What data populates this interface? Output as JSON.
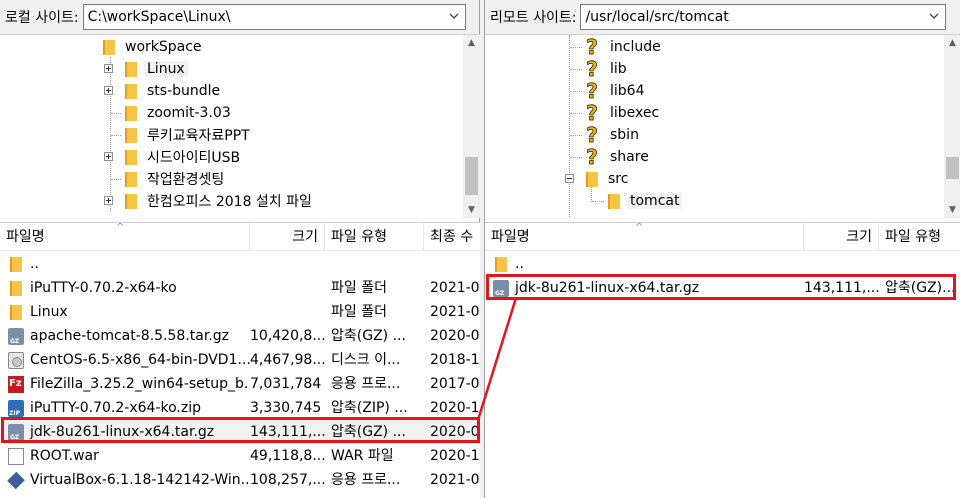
{
  "local": {
    "label": "로컬 사이트:",
    "path": "C:\\workSpace\\Linux\\",
    "tree": [
      {
        "label": "workSpace",
        "icon": "folder-icon",
        "expander": "none"
      },
      {
        "label": "Linux",
        "icon": "folder-icon",
        "expander": "plus",
        "selected": true
      },
      {
        "label": "sts-bundle",
        "icon": "folder-icon",
        "expander": "plus"
      },
      {
        "label": "zoomit-3.03",
        "icon": "folder-icon",
        "expander": "none"
      },
      {
        "label": "루키교육자료PPT",
        "icon": "folder-icon",
        "expander": "none"
      },
      {
        "label": "시드아이티USB",
        "icon": "folder-icon",
        "expander": "plus"
      },
      {
        "label": "작업환경셋팅",
        "icon": "folder-icon",
        "expander": "none"
      },
      {
        "label": "한컴오피스 2018 설치 파일",
        "icon": "folder-icon",
        "expander": "plus"
      }
    ],
    "columns": {
      "name": "파일명",
      "size": "크기",
      "type": "파일 유형",
      "modified": "최종 수"
    },
    "files": [
      {
        "name": "..",
        "size": "",
        "type": "",
        "modified": "",
        "icon": "folder"
      },
      {
        "name": "iPuTTY-0.70.2-x64-ko",
        "size": "",
        "type": "파일 폴더",
        "modified": "2021-0",
        "icon": "folder"
      },
      {
        "name": "Linux",
        "size": "",
        "type": "파일 폴더",
        "modified": "2021-0",
        "icon": "folder"
      },
      {
        "name": "apache-tomcat-8.5.58.tar.gz",
        "size": "10,420,8...",
        "type": "압축(GZ) ...",
        "modified": "2020-0",
        "icon": "gz"
      },
      {
        "name": "CentOS-6.5-x86_64-bin-DVD1....",
        "size": "4,467,98...",
        "type": "디스크 이...",
        "modified": "2018-1",
        "icon": "iso"
      },
      {
        "name": "FileZilla_3.25.2_win64-setup_b...",
        "size": "7,031,784",
        "type": "응용 프로...",
        "modified": "2017-0",
        "icon": "fz"
      },
      {
        "name": "iPuTTY-0.70.2-x64-ko.zip",
        "size": "3,330,745",
        "type": "압축(ZIP) ...",
        "modified": "2020-1",
        "icon": "zip"
      },
      {
        "name": "jdk-8u261-linux-x64.tar.gz",
        "size": "143,111,...",
        "type": "압축(GZ) ...",
        "modified": "2020-0",
        "icon": "gz",
        "selected": true
      },
      {
        "name": "ROOT.war",
        "size": "49,118,8...",
        "type": "WAR 파일",
        "modified": "2020-1",
        "icon": "war"
      },
      {
        "name": "VirtualBox-6.1.18-142142-Win....",
        "size": "108,257,...",
        "type": "응용 프로...",
        "modified": "2021-0",
        "icon": "vbox"
      }
    ]
  },
  "remote": {
    "label": "리모트 사이트:",
    "path": "/usr/local/src/tomcat",
    "tree": [
      {
        "label": "include",
        "icon": "question-icon"
      },
      {
        "label": "lib",
        "icon": "question-icon"
      },
      {
        "label": "lib64",
        "icon": "question-icon"
      },
      {
        "label": "libexec",
        "icon": "question-icon"
      },
      {
        "label": "sbin",
        "icon": "question-icon"
      },
      {
        "label": "share",
        "icon": "question-icon"
      },
      {
        "label": "src",
        "icon": "folder-icon",
        "expander": "minus"
      },
      {
        "label": "tomcat",
        "icon": "folder-icon",
        "selected": true
      }
    ],
    "columns": {
      "name": "파일명",
      "size": "크기",
      "type": "파일 유형"
    },
    "files": [
      {
        "name": "..",
        "size": "",
        "type": "",
        "icon": "folder"
      },
      {
        "name": "jdk-8u261-linux-x64.tar.gz",
        "size": "143,111,...",
        "type": "압축(GZ)...",
        "icon": "gz",
        "highlighted": true
      }
    ]
  },
  "highlight_color": "#e0161e"
}
